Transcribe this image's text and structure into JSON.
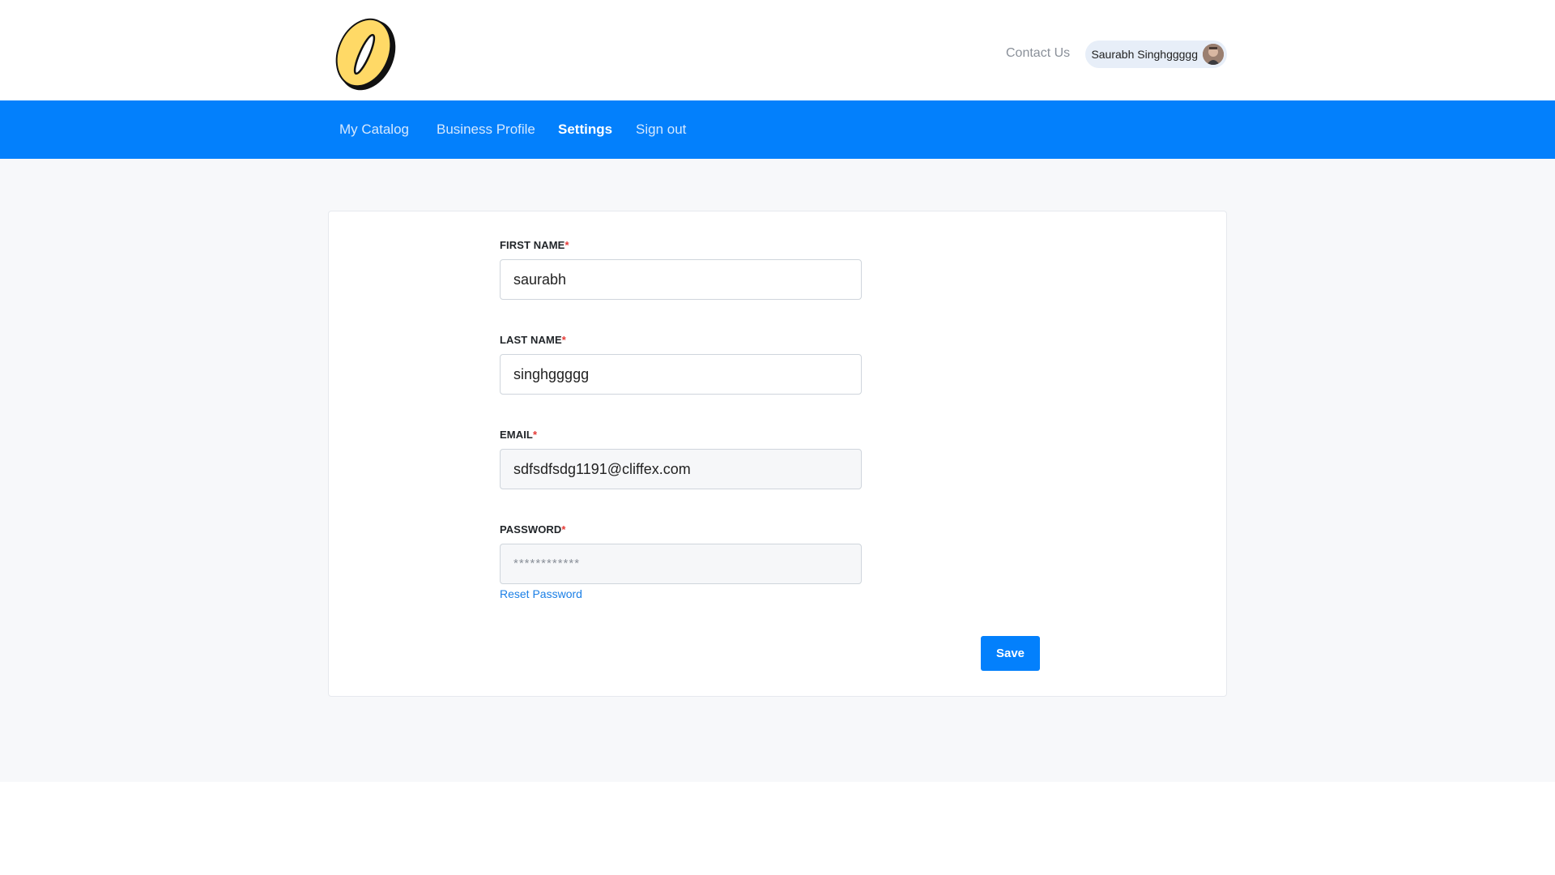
{
  "header": {
    "contact_label": "Contact Us",
    "user_name": "Saurabh Singhggggg"
  },
  "nav": {
    "items": [
      {
        "label": "My Catalog",
        "active": false
      },
      {
        "label": "Business Profile",
        "active": false
      },
      {
        "label": "Settings",
        "active": true
      },
      {
        "label": "Sign out",
        "active": false
      }
    ]
  },
  "form": {
    "first_name": {
      "label": "FIRST NAME",
      "required_mark": "*",
      "value": "saurabh"
    },
    "last_name": {
      "label": "LAST NAME",
      "required_mark": "*",
      "value": "singhggggg"
    },
    "email": {
      "label": "EMAIL",
      "required_mark": "*",
      "value": "sdfsdfsdg1191@cliffex.com"
    },
    "password": {
      "label": "PASSWORD",
      "required_mark": "*",
      "value": "************"
    },
    "reset_password_label": "Reset Password",
    "save_label": "Save"
  },
  "colors": {
    "accent": "#0380fc",
    "logo_fill": "#ffd966",
    "required": "#e53935"
  },
  "icons": {
    "logo": "brand-logo",
    "avatar": "user-avatar"
  }
}
